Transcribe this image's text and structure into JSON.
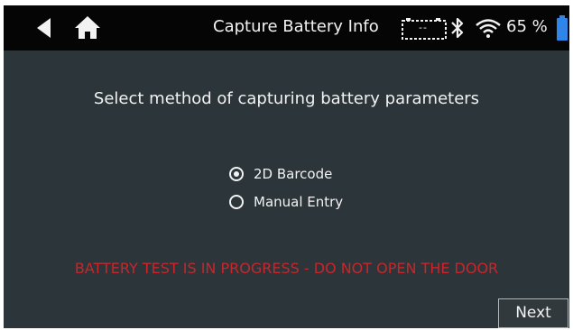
{
  "header": {
    "title": "Capture Battery Info",
    "battery_icon_text": "--",
    "battery_percent": "65 %",
    "back_icon": "back-arrow-icon",
    "home_icon": "home-icon",
    "bluetooth_icon": "bluetooth-icon",
    "wifi_icon": "wifi-icon"
  },
  "main": {
    "prompt": "Select method of capturing battery parameters",
    "options": [
      {
        "label": "2D Barcode",
        "selected": true
      },
      {
        "label": "Manual Entry",
        "selected": false
      }
    ],
    "warning": "BATTERY TEST IS IN PROGRESS - DO NOT OPEN THE DOOR"
  },
  "footer": {
    "next_label": "Next"
  },
  "colors": {
    "background": "#2c3539",
    "topbar": "#050505",
    "text": "#f2f2f2",
    "warning": "#c8262b",
    "battery_accent": "#2f86e8"
  }
}
